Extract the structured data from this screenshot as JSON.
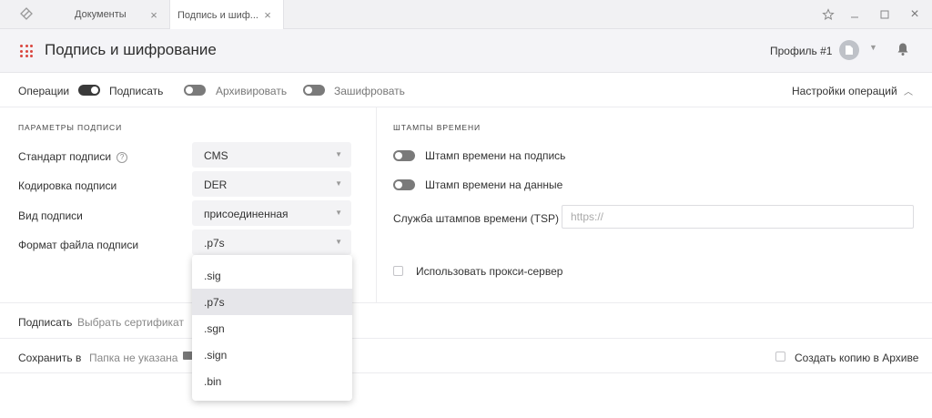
{
  "titlebar": {
    "tabs": [
      {
        "label": "Документы",
        "close": "×"
      },
      {
        "label": "Подпись и шиф...",
        "close": "×"
      }
    ],
    "icons": [
      "app-logo-icon",
      "star-icon",
      "minimize-icon",
      "maximize-icon",
      "close-icon"
    ],
    "close_glyph": "×"
  },
  "header": {
    "title": "Подпись и шифрование",
    "profile": "Профиль #1",
    "accent": "#d9473f"
  },
  "operations": {
    "label": "Операции",
    "items": [
      {
        "label": "Подписать",
        "on": true
      },
      {
        "label": "Архивировать",
        "on": false
      },
      {
        "label": "Зашифровать",
        "on": false
      }
    ],
    "settings_label": "Настройки операций"
  },
  "signature_params": {
    "title": "ПАРАМЕТРЫ ПОДПИСИ",
    "help_glyph": "?",
    "fields": [
      {
        "label": "Стандарт подписи",
        "value": "CMS"
      },
      {
        "label": "Кодировка подписи",
        "value": "DER"
      },
      {
        "label": "Вид подписи",
        "value": "присоединенная"
      },
      {
        "label": "Формат файла подписи",
        "value": ".p7s"
      }
    ]
  },
  "timestamps": {
    "title": "ШТАМПЫ ВРЕМЕНИ",
    "toggles": [
      {
        "label": "Штамп времени на подпись",
        "on": false
      },
      {
        "label": "Штамп времени на данные",
        "on": false
      }
    ],
    "tsp_label": "Служба штампов времени (TSP)",
    "tsp_placeholder": "https://",
    "proxy_label": "Использовать прокси-сервер"
  },
  "sign_row": {
    "label": "Подписать",
    "certificate": "Выбрать сертификат"
  },
  "save_row": {
    "label": "Сохранить в",
    "folder": "Папка не указана",
    "archive_copy": "Создать копию в Архиве"
  },
  "dropdown": {
    "options": [
      ".sig",
      ".p7s",
      ".sgn",
      ".sign",
      ".bin"
    ],
    "selected": ".p7s"
  }
}
